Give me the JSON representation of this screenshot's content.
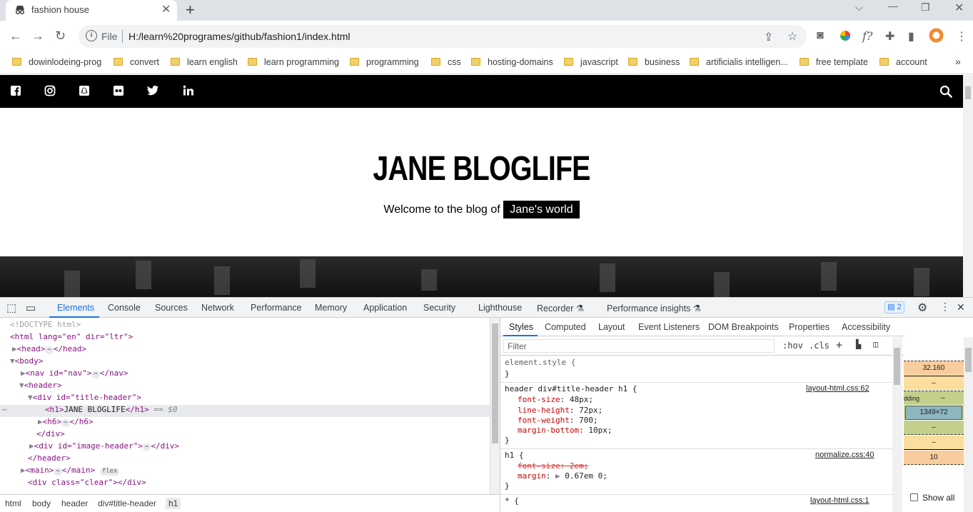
{
  "browser": {
    "tab_title": "fashion house",
    "url_scheme": "File",
    "url": "H:/learn%20programes/github/fashion1/index.html",
    "bookmarks": [
      "dowinlodeing-prog",
      "convert",
      "learn english",
      "learn programming",
      "programming",
      "css",
      "hosting-domains",
      "javascript",
      "business",
      "artificialis intelligen...",
      "free template",
      "account"
    ],
    "more_bookmarks": "»"
  },
  "site": {
    "social_icons": [
      "facebook-icon",
      "instagram-icon",
      "snapchat-icon",
      "flickr-icon",
      "twitter-icon",
      "linkedin-icon"
    ],
    "title": "JANE BLOGLIFE",
    "tagline_prefix": "Welcome to the blog of",
    "tagline_highlight": "Jane's world"
  },
  "devtools": {
    "tabs": [
      "Elements",
      "Console",
      "Sources",
      "Network",
      "Performance",
      "Memory",
      "Application",
      "Security",
      "Lighthouse",
      "Recorder ⚗",
      "Performance insights ⚗"
    ],
    "active_tab": "Elements",
    "issues_count": "2",
    "dom": {
      "doctype": "<!DOCTYPE html>",
      "html_open": "<html lang=\"en\" dir=\"ltr\">",
      "head": "<head>",
      "head_close": "</head>",
      "body": "<body>",
      "nav": "<nav id=\"nav\">",
      "nav_close": "</nav>",
      "header": "<header>",
      "title_header": "<div id=\"title-header\">",
      "h1_open": "<h1>",
      "h1_text": "JANE BLOGLIFE",
      "h1_close": "</h1>",
      "h1_marker": "== $0",
      "h6": "<h6>",
      "h6_close": "</h6>",
      "div_close": "</div>",
      "image_header": "<div id=\"image-header\">",
      "image_header_close": "</div>",
      "header_close": "</header>",
      "main": "<main>",
      "main_close": "</main>",
      "flex_badge": "flex",
      "clear_div": "<div class=\"clear\"></div>"
    },
    "breadcrumbs": [
      "html",
      "body",
      "header",
      "div#title-header",
      "h1"
    ],
    "styles_tabs": [
      "Styles",
      "Computed",
      "Layout",
      "Event Listeners",
      "DOM Breakpoints",
      "Properties",
      "Accessibility"
    ],
    "filter_placeholder": "Filter",
    "filter_tools": [
      ":hov",
      ".cls"
    ],
    "rules": {
      "element_style": "element.style {",
      "close": "}",
      "r1_selector": "header div#title-header h1 {",
      "r1_source": "layout-html.css:62",
      "r1_props": [
        {
          "name": "font-size",
          "value": "48px;"
        },
        {
          "name": "line-height",
          "value": "72px;"
        },
        {
          "name": "font-weight",
          "value": "700;"
        },
        {
          "name": "margin-bottom",
          "value": "10px;"
        }
      ],
      "r2_selector": "h1 {",
      "r2_source": "normalize.css:40",
      "r2_strike": "font-size: 2em;",
      "r2_margin_name": "margin",
      "r2_margin_value": "0.67em 0;",
      "r3_selector": "* {",
      "r3_source": "layout-html.css:1"
    },
    "box_model": {
      "margin_top": "32.160",
      "border": "–",
      "padding_label": "dding",
      "padding_val": "–",
      "content": "1349×72",
      "padding_bottom": "–",
      "border_bottom": "–",
      "margin_bottom": "10",
      "show_all": "Show all"
    },
    "colors": {
      "accent": "#1a73e8",
      "margin": "#f9cc9d",
      "border": "#fbdd9d",
      "padding": "#c3d08b",
      "content": "#8cb6c0"
    }
  }
}
